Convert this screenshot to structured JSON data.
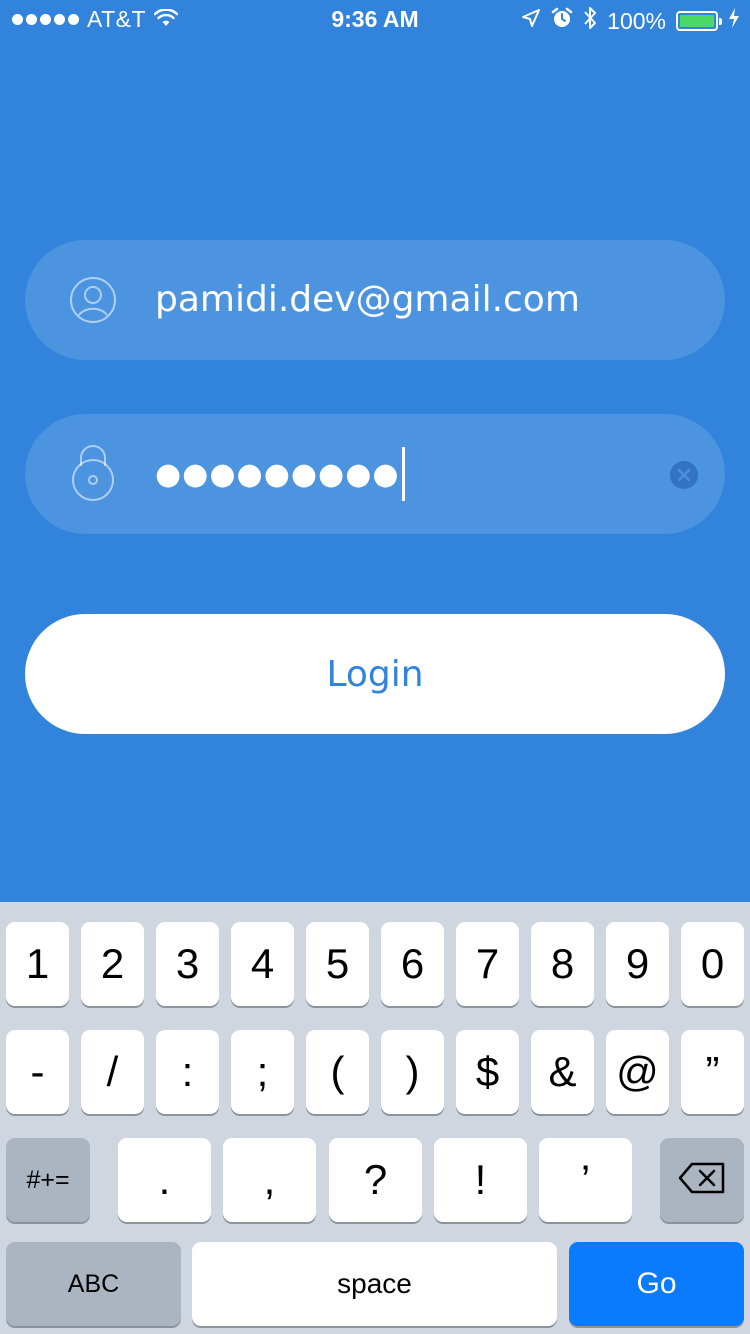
{
  "status_bar": {
    "carrier": "AT&T",
    "time": "9:36 AM",
    "battery_percent": "100%",
    "battery_level": 1.0,
    "icons": [
      "signal-dots",
      "wifi-icon",
      "location-arrow-icon",
      "alarm-icon",
      "bluetooth-icon",
      "battery-icon",
      "charging-icon"
    ]
  },
  "form": {
    "email": {
      "value": "pamidi.dev@gmail.com",
      "icon": "user-icon"
    },
    "password": {
      "masked_value": "●●●●●●●●●",
      "icon": "lock-icon",
      "clear_icon": "clear-icon"
    },
    "login_label": "Login"
  },
  "keyboard": {
    "row1": [
      "1",
      "2",
      "3",
      "4",
      "5",
      "6",
      "7",
      "8",
      "9",
      "0"
    ],
    "row2": [
      "-",
      "/",
      ":",
      ";",
      "(",
      ")",
      "$",
      "&",
      "@",
      "”"
    ],
    "row3": [
      "#+=",
      ".",
      ",",
      "?",
      "!",
      "’"
    ],
    "row4": [
      "ABC",
      "space",
      "Go"
    ],
    "delete_icon": "backspace-icon"
  },
  "colors": {
    "background": "#3283dc",
    "accent": "#3283dc",
    "go_key": "#0a7aff",
    "keyboard_bg": "#cfd6df",
    "battery_fill": "#4cd964"
  }
}
